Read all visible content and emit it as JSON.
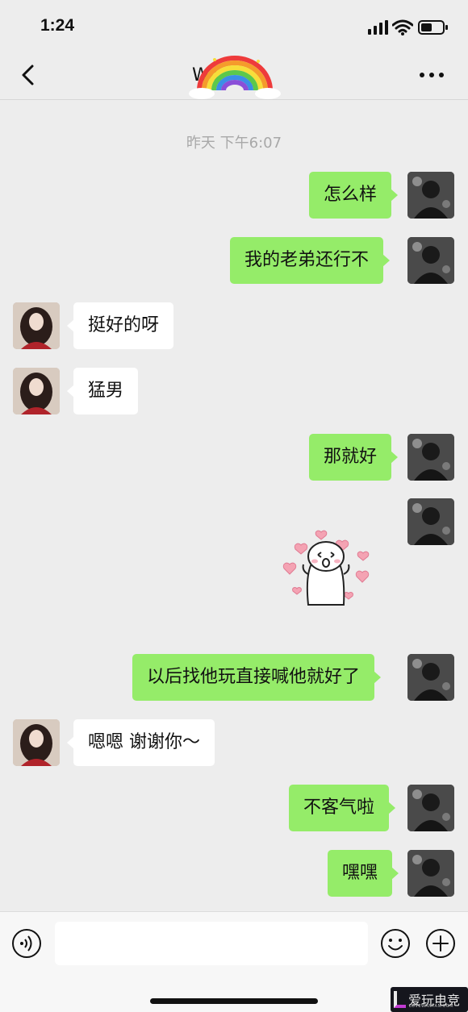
{
  "status_bar": {
    "time": "1:24"
  },
  "header": {
    "title": "Wa"
  },
  "chat": {
    "timestamp": "昨天 下午6:07",
    "messages": [
      {
        "from": "me",
        "text": "怎么样"
      },
      {
        "from": "me",
        "text": "我的老弟还行不"
      },
      {
        "from": "her",
        "text": "挺好的呀"
      },
      {
        "from": "her",
        "text": "猛男"
      },
      {
        "from": "me",
        "text": "那就好"
      },
      {
        "from": "me",
        "sticker": "hearts-sticker"
      },
      {
        "from": "me",
        "text": "以后找他玩直接喊他就好了"
      },
      {
        "from": "her",
        "text": "嗯嗯 谢谢你～"
      },
      {
        "from": "me",
        "text": "不客气啦"
      },
      {
        "from": "me",
        "text": "嘿嘿"
      }
    ]
  },
  "input_bar": {
    "placeholder": ""
  },
  "watermark": {
    "text": "爱玩电竞",
    "sub": "LOVEWANYAN.COM"
  },
  "colors": {
    "sent_bubble": "#95ec69",
    "received_bubble": "#ffffff",
    "background": "#ededed"
  },
  "icons": [
    "back-icon",
    "more-icon",
    "voice-icon",
    "emoji-icon",
    "plus-icon",
    "signal-icon",
    "wifi-icon",
    "battery-icon"
  ]
}
